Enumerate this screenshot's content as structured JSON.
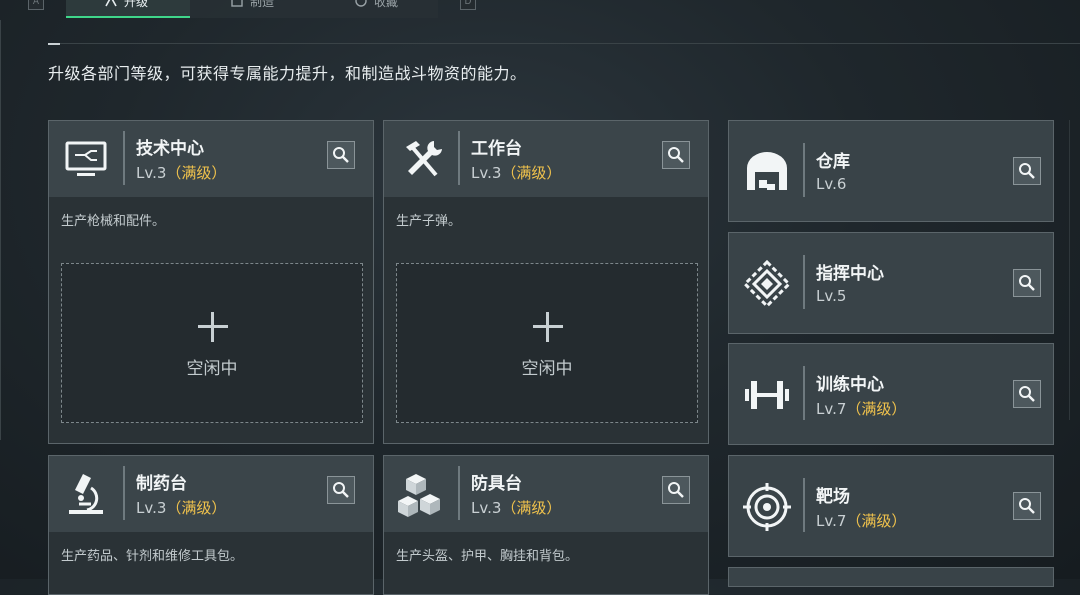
{
  "hotkeys": {
    "left": "A",
    "right": "D"
  },
  "tabs": [
    {
      "label": "升级",
      "icon": "upgrade-icon",
      "active": true
    },
    {
      "label": "制造",
      "icon": "craft-icon",
      "active": false
    },
    {
      "label": "收藏",
      "icon": "collection-icon",
      "active": false
    }
  ],
  "subtitle": "升级各部门等级，可获得专属能力提升，和制造战斗物资的能力。",
  "card_header_text": "",
  "max_level_text": "（满级）",
  "idle_label": "空闲中",
  "colors": {
    "accent": "#3fd68a",
    "max_level": "#f0c24c"
  },
  "departments": [
    {
      "name": "技术中心",
      "level": "Lv.3",
      "max": true,
      "icon": "computer-icon",
      "desc": "生产枪械和配件。",
      "idle": true
    },
    {
      "name": "工作台",
      "level": "Lv.3",
      "max": true,
      "icon": "tools-icon",
      "desc": "生产子弹。",
      "idle": true
    },
    {
      "name": "制药台",
      "level": "Lv.3",
      "max": true,
      "icon": "microscope-icon",
      "desc": "生产药品、针剂和维修工具包。"
    },
    {
      "name": "防具台",
      "level": "Lv.3",
      "max": true,
      "icon": "cubes-icon",
      "desc": "生产头盔、护甲、胸挂和背包。"
    }
  ],
  "side_departments": [
    {
      "name": "仓库",
      "level": "Lv.6",
      "max": false,
      "icon": "warehouse-icon"
    },
    {
      "name": "指挥中心",
      "level": "Lv.5",
      "max": false,
      "icon": "command-icon"
    },
    {
      "name": "训练中心",
      "level": "Lv.7",
      "max": true,
      "icon": "dumbbell-icon"
    },
    {
      "name": "靶场",
      "level": "Lv.7",
      "max": true,
      "icon": "target-icon"
    }
  ]
}
